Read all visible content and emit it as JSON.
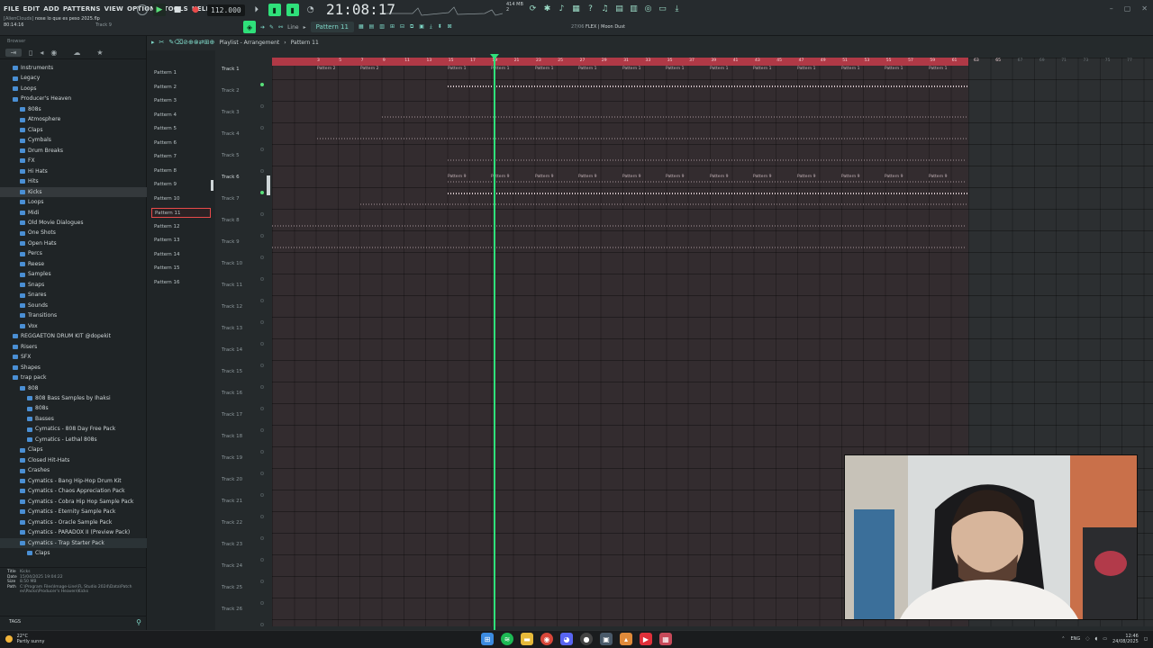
{
  "menu": [
    "FILE",
    "EDIT",
    "ADD",
    "PATTERNS",
    "VIEW",
    "OPTIONS",
    "TOOLS",
    "HELP"
  ],
  "song": {
    "user": "[AlienClouds]",
    "title": "nose lo que es peso 2025.flp",
    "time": "80:14:16",
    "track": "Track 9"
  },
  "transport": {
    "tempo": "112.000",
    "clock": "21:08:17",
    "clock_sub": "M:S:CS",
    "mem": "414 MB",
    "cpu_count": "2"
  },
  "toolbar2": {
    "snap": "Line",
    "pattern": "Pattern 11",
    "hint_date": "27/06",
    "hint_text": "FLEX | Moon Dust"
  },
  "playlist": {
    "title": "Playlist - Arrangement",
    "crumb": "Pattern 11"
  },
  "browser": {
    "header": "Browser",
    "items": [
      {
        "label": "Instruments",
        "indent": 0
      },
      {
        "label": "Legacy",
        "indent": 0
      },
      {
        "label": "Loops",
        "indent": 0
      },
      {
        "label": "Producer's Heaven",
        "indent": 0
      },
      {
        "label": "808s",
        "indent": 1
      },
      {
        "label": "Atmosphere",
        "indent": 1
      },
      {
        "label": "Claps",
        "indent": 1
      },
      {
        "label": "Cymbals",
        "indent": 1
      },
      {
        "label": "Drum Breaks",
        "indent": 1
      },
      {
        "label": "FX",
        "indent": 1
      },
      {
        "label": "Hi Hats",
        "indent": 1
      },
      {
        "label": "Hits",
        "indent": 1
      },
      {
        "label": "Kicks",
        "indent": 1
      },
      {
        "label": "Loops",
        "indent": 1
      },
      {
        "label": "Midi",
        "indent": 1
      },
      {
        "label": "Old Movie Dialogues",
        "indent": 1
      },
      {
        "label": "One Shots",
        "indent": 1
      },
      {
        "label": "Open Hats",
        "indent": 1
      },
      {
        "label": "Percs",
        "indent": 1
      },
      {
        "label": "Reese",
        "indent": 1
      },
      {
        "label": "Samples",
        "indent": 1
      },
      {
        "label": "Snaps",
        "indent": 1
      },
      {
        "label": "Snares",
        "indent": 1
      },
      {
        "label": "Sounds",
        "indent": 1
      },
      {
        "label": "Transitions",
        "indent": 1
      },
      {
        "label": "Vox",
        "indent": 1
      },
      {
        "label": "REGGAETON DRUM KIT @dopekit",
        "indent": 0
      },
      {
        "label": "Risers",
        "indent": 0
      },
      {
        "label": "SFX",
        "indent": 0
      },
      {
        "label": "Shapes",
        "indent": 0
      },
      {
        "label": "trap pack",
        "indent": 0
      },
      {
        "label": "808",
        "indent": 1
      },
      {
        "label": "808 Bass Samples by Ihaksi",
        "indent": 2
      },
      {
        "label": "808s",
        "indent": 2
      },
      {
        "label": "Basses",
        "indent": 2
      },
      {
        "label": "Cymatics - 808 Day Free Pack",
        "indent": 2
      },
      {
        "label": "Cymatics - Lethal 808s",
        "indent": 2
      },
      {
        "label": "Claps",
        "indent": 1
      },
      {
        "label": "Closed Hit-Hats",
        "indent": 1
      },
      {
        "label": "Crashes",
        "indent": 1
      },
      {
        "label": "Cymatics - Bang Hip-Hop Drum Kit",
        "indent": 1
      },
      {
        "label": "Cymatics - Chaos Appreciation Pack",
        "indent": 1
      },
      {
        "label": "Cymatics - Cobra Hip Hop Sample Pack",
        "indent": 1
      },
      {
        "label": "Cymatics - Eternity Sample Pack",
        "indent": 1
      },
      {
        "label": "Cymatics - Oracle Sample Pack",
        "indent": 1
      },
      {
        "label": "Cymatics - PARADOX II (Preview Pack)",
        "indent": 1
      },
      {
        "label": "Cymatics - Trap Starter Pack",
        "indent": 1
      },
      {
        "label": "Claps",
        "indent": 2
      }
    ],
    "info": {
      "title_label": "Title",
      "title_val": "Kicks",
      "date_label": "Date",
      "date_val": "15/04/2025 19:04:22",
      "size_label": "Size",
      "size_val": "8.50 MB",
      "path_label": "Path",
      "path_val": "C:\\Program Files\\Image-Line\\FL Studio 2024\\Data\\Patches\\Packs\\Producer's Heaven\\Kicks"
    },
    "tags_label": "TAGS"
  },
  "patterns": [
    "Pattern 1",
    "Pattern 2",
    "Pattern 3",
    "Pattern 4",
    "Pattern 5",
    "Pattern 6",
    "Pattern 7",
    "Pattern 8",
    "Pattern 9",
    "Pattern 10",
    "Pattern 11",
    "Pattern 12",
    "Pattern 13",
    "Pattern 14",
    "Pattern 15",
    "Pattern 16"
  ],
  "selected_pattern": "Pattern 11",
  "tracks": [
    "Track 1",
    "Track 2",
    "Track 3",
    "Track 4",
    "Track 5",
    "Track 6",
    "Track 7",
    "Track 8",
    "Track 9",
    "Track 10",
    "Track 11",
    "Track 12",
    "Track 13",
    "Track 14",
    "Track 15",
    "Track 16",
    "Track 17",
    "Track 18",
    "Track 19",
    "Track 20",
    "Track 21",
    "Track 22",
    "Track 23",
    "Track 24",
    "Track 25",
    "Track 26"
  ],
  "ruler_ticks": [
    "3",
    "5",
    "7",
    "9",
    "11",
    "13",
    "15",
    "17",
    "19",
    "21",
    "23",
    "25",
    "27",
    "29",
    "31",
    "33",
    "35",
    "37",
    "39",
    "41",
    "43",
    "45",
    "47",
    "49",
    "51",
    "53",
    "55",
    "57",
    "59",
    "61",
    "63",
    "65",
    "67",
    "69",
    "71",
    "73",
    "75",
    "77"
  ],
  "clips": {
    "track1": [
      "Pattern 2",
      "Pattern 2",
      "Pattern 1",
      "Pattern 1",
      "Pattern 1",
      "Pattern 1",
      "Pattern 1",
      "Pattern 1",
      "Pattern 1",
      "Pattern 1",
      "Pattern 1",
      "Pattern 1",
      "Pattern 1",
      "Pattern 1",
      "Pattern 1",
      "Pattern 1",
      "Pattern 1",
      "Pattern 1",
      "Pattern 1",
      "Pattern 1",
      "Pattern 1",
      "Pattern 1"
    ],
    "track6": [
      "Pattern 9",
      "Pattern 9",
      "Pattern 9",
      "Pattern 9",
      "Pattern 9",
      "Pattern 9",
      "Pattern 9",
      "Pattern 9",
      "Pattern 9",
      "Pattern 9",
      "Pattern 9",
      "Pattern 9",
      "Pattern 9",
      "Pattern 9",
      "Pattern 9",
      "Pattern 9",
      "Pattern 9"
    ]
  },
  "taskbar": {
    "temp": "22°C",
    "weather": "Partly sunny",
    "lang": "ENG",
    "time": "12:46",
    "date": "24/08/2025"
  },
  "colors": {
    "accent": "#2fe07a",
    "ruler": "#b03946",
    "folder": "#4a8fd4",
    "selection": "#e94a4a"
  }
}
